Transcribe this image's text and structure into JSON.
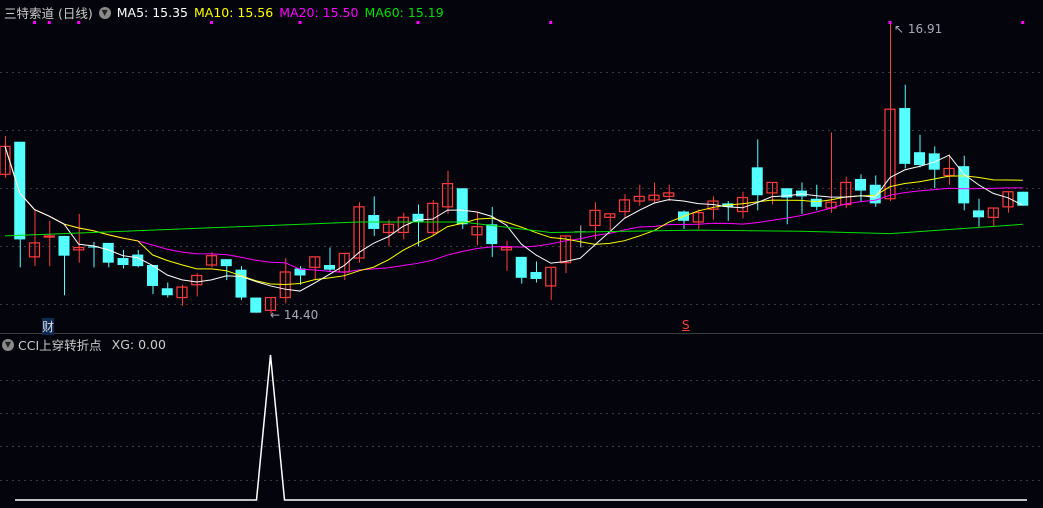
{
  "header": {
    "title": "三特索道 (日线)",
    "ma5": "MA5: 15.35",
    "ma10": "MA10: 15.56",
    "ma20": "MA20: 15.50",
    "ma60": "MA60: 15.19"
  },
  "colors": {
    "up": "#ff3b3b",
    "down": "#54ffff",
    "doji": "#c0c0c0",
    "ma5": "#ffffff",
    "ma10": "#ffff00",
    "ma20": "#ff00ff",
    "ma60": "#00e000",
    "grid": "#3a3a44"
  },
  "annotations": {
    "high_label": "16.91",
    "low_label": "14.40",
    "fin_marker": "财",
    "s_marker": "S"
  },
  "sub_panel": {
    "title": "CCI上穿转折点",
    "xg": "XG: 0.00"
  },
  "chart_data": {
    "type": "candlestick",
    "price_range": [
      14.3,
      16.98
    ],
    "candles_ohlc": [
      [
        15.6,
        15.93,
        15.57,
        15.84
      ],
      [
        15.88,
        15.88,
        14.8,
        15.04
      ],
      [
        14.89,
        15.29,
        14.81,
        15.01
      ],
      [
        15.06,
        15.2,
        14.81,
        15.07
      ],
      [
        15.07,
        15.07,
        14.56,
        14.9
      ],
      [
        14.95,
        15.26,
        14.84,
        14.97
      ],
      [
        14.98,
        15.02,
        14.8,
        14.97
      ],
      [
        15.01,
        15.01,
        14.8,
        14.84
      ],
      [
        14.88,
        14.95,
        14.79,
        14.82
      ],
      [
        14.91,
        14.95,
        14.8,
        14.81
      ],
      [
        14.82,
        14.82,
        14.57,
        14.64
      ],
      [
        14.62,
        14.67,
        14.54,
        14.56
      ],
      [
        14.54,
        14.65,
        14.47,
        14.63
      ],
      [
        14.65,
        14.75,
        14.55,
        14.73
      ],
      [
        14.82,
        14.93,
        14.8,
        14.9
      ],
      [
        14.87,
        14.87,
        14.69,
        14.81
      ],
      [
        14.78,
        14.81,
        14.52,
        14.54
      ],
      [
        14.54,
        14.54,
        14.41,
        14.41
      ],
      [
        14.43,
        14.54,
        14.4,
        14.54
      ],
      [
        14.54,
        14.88,
        14.49,
        14.76
      ],
      [
        14.79,
        14.81,
        14.65,
        14.73
      ],
      [
        14.8,
        14.89,
        14.69,
        14.89
      ],
      [
        14.82,
        14.97,
        14.76,
        14.78
      ],
      [
        14.76,
        14.92,
        14.69,
        14.92
      ],
      [
        14.88,
        15.36,
        14.84,
        15.32
      ],
      [
        15.25,
        15.41,
        15.07,
        15.13
      ],
      [
        15.1,
        15.21,
        14.98,
        15.17
      ],
      [
        15.1,
        15.27,
        15.04,
        15.23
      ],
      [
        15.26,
        15.34,
        14.98,
        15.19
      ],
      [
        15.1,
        15.38,
        15.07,
        15.35
      ],
      [
        15.32,
        15.63,
        15.26,
        15.52
      ],
      [
        15.48,
        15.48,
        15.13,
        15.17
      ],
      [
        15.08,
        15.28,
        14.99,
        15.15
      ],
      [
        15.17,
        15.32,
        14.89,
        15.0
      ],
      [
        14.95,
        15.03,
        14.77,
        14.97
      ],
      [
        14.89,
        14.89,
        14.66,
        14.71
      ],
      [
        14.76,
        14.85,
        14.67,
        14.7
      ],
      [
        14.64,
        14.8,
        14.52,
        14.8
      ],
      [
        14.84,
        15.07,
        14.75,
        15.07
      ],
      [
        15.11,
        15.16,
        14.97,
        15.11
      ],
      [
        15.16,
        15.36,
        15.04,
        15.29
      ],
      [
        15.23,
        15.26,
        15.12,
        15.26
      ],
      [
        15.28,
        15.43,
        15.22,
        15.38
      ],
      [
        15.37,
        15.51,
        15.33,
        15.41
      ],
      [
        15.38,
        15.53,
        15.35,
        15.42
      ],
      [
        15.41,
        15.51,
        15.37,
        15.44
      ],
      [
        15.28,
        15.29,
        15.13,
        15.2
      ],
      [
        15.19,
        15.3,
        15.13,
        15.27
      ],
      [
        15.3,
        15.41,
        15.21,
        15.37
      ],
      [
        15.35,
        15.37,
        15.2,
        15.32
      ],
      [
        15.28,
        15.45,
        15.22,
        15.4
      ],
      [
        15.66,
        15.9,
        15.29,
        15.42
      ],
      [
        15.44,
        15.53,
        15.34,
        15.53
      ],
      [
        15.48,
        15.48,
        15.17,
        15.4
      ],
      [
        15.46,
        15.53,
        15.26,
        15.41
      ],
      [
        15.39,
        15.51,
        15.29,
        15.32
      ],
      [
        15.31,
        15.96,
        15.27,
        15.36
      ],
      [
        15.34,
        15.58,
        15.31,
        15.53
      ],
      [
        15.56,
        15.6,
        15.36,
        15.46
      ],
      [
        15.51,
        15.59,
        15.32,
        15.35
      ],
      [
        15.39,
        16.91,
        15.37,
        16.16
      ],
      [
        16.17,
        16.37,
        15.65,
        15.69
      ],
      [
        15.79,
        15.94,
        15.66,
        15.68
      ],
      [
        15.78,
        15.84,
        15.48,
        15.64
      ],
      [
        15.59,
        15.77,
        15.51,
        15.65
      ],
      [
        15.67,
        15.76,
        15.29,
        15.35
      ],
      [
        15.29,
        15.39,
        15.15,
        15.23
      ],
      [
        15.23,
        15.31,
        15.15,
        15.31
      ],
      [
        15.32,
        15.45,
        15.27,
        15.45
      ],
      [
        15.45,
        15.45,
        15.33,
        15.33
      ]
    ],
    "ma60_anchors": [
      [
        0,
        15.07
      ],
      [
        14,
        15.14
      ],
      [
        24,
        15.19
      ],
      [
        31,
        15.19
      ],
      [
        37,
        15.1
      ],
      [
        47,
        15.12
      ],
      [
        54,
        15.11
      ],
      [
        60,
        15.09
      ],
      [
        69,
        15.17
      ]
    ],
    "signal_markers": [
      2,
      3,
      5,
      14,
      20,
      28,
      37,
      60,
      69
    ],
    "high_index": 60,
    "low_index": 18,
    "fin_index": 3,
    "s_index": 46,
    "xg_values_spike_index": 18,
    "xg_range": [
      0,
      1
    ]
  }
}
